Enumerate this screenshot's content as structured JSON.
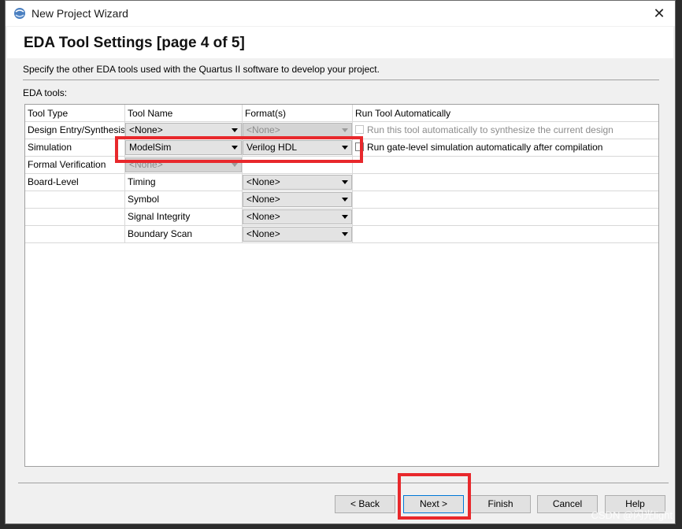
{
  "window": {
    "title": "New Project Wizard"
  },
  "heading": "EDA Tool Settings [page 4 of 5]",
  "description": "Specify the other EDA tools used with the Quartus II software to develop your project.",
  "eda_tools_label": "EDA tools:",
  "table": {
    "headers": [
      "Tool Type",
      "Tool Name",
      "Format(s)",
      "Run Tool Automatically"
    ],
    "rows": [
      {
        "type": "Design Entry/Synthesis",
        "tool": "<None>",
        "format": "<None>",
        "run_label": "Run this tool automatically to synthesize the current design"
      },
      {
        "type": "Simulation",
        "tool": "ModelSim",
        "format": "Verilog HDL",
        "run_label": "Run gate-level simulation automatically after compilation"
      },
      {
        "type": "Formal Verification",
        "tool": "<None>"
      },
      {
        "type": "Board-Level",
        "tool": "Timing",
        "format": "<None>"
      },
      {
        "tool": "Symbol",
        "format": "<None>"
      },
      {
        "tool": "Signal Integrity",
        "format": "<None>"
      },
      {
        "tool": "Boundary Scan",
        "format": "<None>"
      }
    ]
  },
  "buttons": {
    "back": "< Back",
    "next": "Next >",
    "finish": "Finish",
    "cancel": "Cancel",
    "help": "Help"
  },
  "watermark": "CSDN @闪光light",
  "colors": {
    "highlight": "#e8282c",
    "dropdown": "#e3e3e3"
  }
}
